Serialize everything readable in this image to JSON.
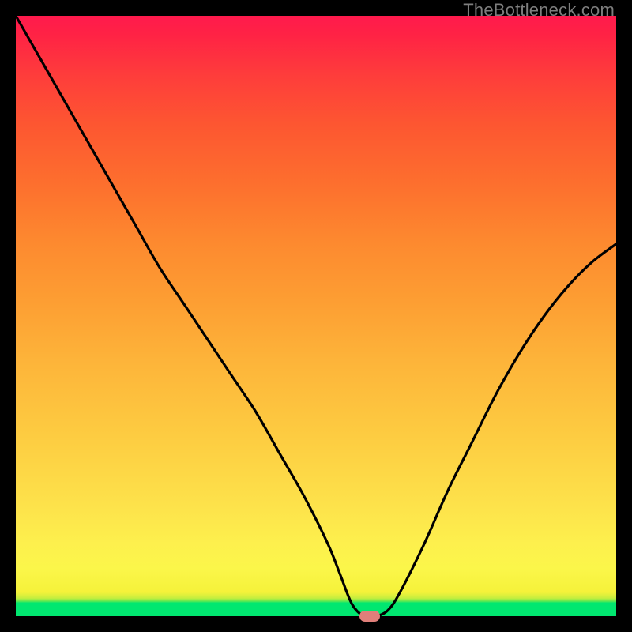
{
  "watermark": "TheBottleneck.com",
  "colors": {
    "frame": "#000000",
    "curve": "#000000",
    "marker": "#e07f7a"
  },
  "chart_data": {
    "type": "line",
    "title": "",
    "xlabel": "",
    "ylabel": "",
    "xlim": [
      0,
      100
    ],
    "ylim": [
      0,
      100
    ],
    "series": [
      {
        "name": "bottleneck-curve",
        "x": [
          0,
          4,
          8,
          12,
          16,
          20,
          24,
          28,
          32,
          36,
          40,
          44,
          48,
          52,
          54,
          56,
          58,
          60,
          62,
          64,
          68,
          72,
          76,
          80,
          84,
          88,
          92,
          96,
          100
        ],
        "values": [
          100,
          93,
          86,
          79,
          72,
          65,
          58,
          52,
          46,
          40,
          34,
          27,
          20,
          12,
          7,
          2,
          0,
          0,
          1,
          4,
          12,
          21,
          29,
          37,
          44,
          50,
          55,
          59,
          62
        ]
      }
    ],
    "marker": {
      "x": 59,
      "y": 0
    },
    "annotations": []
  }
}
